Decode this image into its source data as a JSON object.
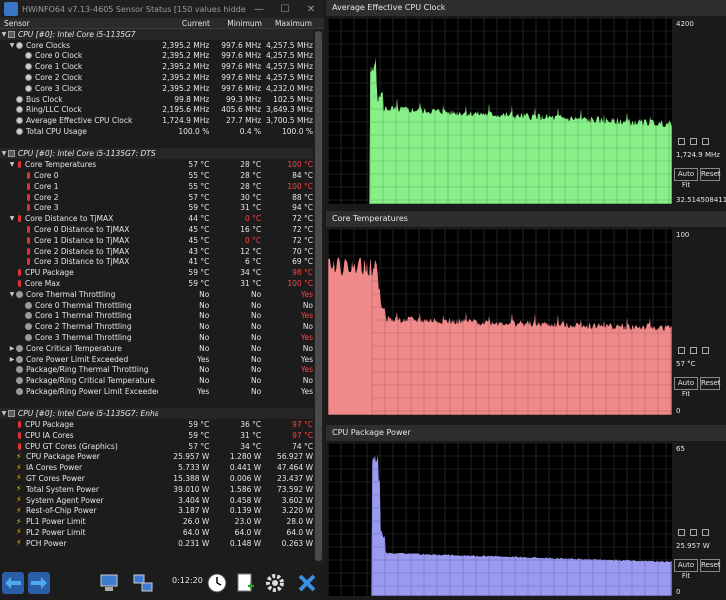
{
  "window": {
    "title": "HWiNFO64 v7.13-4605 Sensor Status [150 values hidden]",
    "min_icon": "minimize-icon",
    "max_icon": "maximize-icon",
    "close_icon": "close-icon"
  },
  "columns": {
    "sensor": "Sensor",
    "current": "Current",
    "minimum": "Minimum",
    "maximum": "Maximum"
  },
  "rows": [
    {
      "type": "group",
      "indent": 0,
      "icon": "cpu-chip-icon",
      "name": "CPU [#0]: Intel Core i5-1135G7"
    },
    {
      "indent": 1,
      "icon": "clock-icon",
      "expand": "v",
      "name": "Core Clocks",
      "cur": "2,395.2 MHz",
      "min": "997.6 MHz",
      "max": "4,257.5 MHz"
    },
    {
      "indent": 2,
      "icon": "clock-icon",
      "name": "Core 0 Clock",
      "cur": "2,395.2 MHz",
      "min": "997.6 MHz",
      "max": "4,257.5 MHz"
    },
    {
      "indent": 2,
      "icon": "clock-icon",
      "name": "Core 1 Clock",
      "cur": "2,395.2 MHz",
      "min": "997.6 MHz",
      "max": "4,257.5 MHz"
    },
    {
      "indent": 2,
      "icon": "clock-icon",
      "name": "Core 2 Clock",
      "cur": "2,395.2 MHz",
      "min": "997.6 MHz",
      "max": "4,257.5 MHz"
    },
    {
      "indent": 2,
      "icon": "clock-icon",
      "name": "Core 3 Clock",
      "cur": "2,395.2 MHz",
      "min": "997.6 MHz",
      "max": "4,232.0 MHz"
    },
    {
      "indent": 1,
      "icon": "clock-icon",
      "name": "Bus Clock",
      "cur": "99.8 MHz",
      "min": "99.3 MHz",
      "max": "102.5 MHz"
    },
    {
      "indent": 1,
      "icon": "clock-icon",
      "name": "Ring/LLC Clock",
      "cur": "2,195.6 MHz",
      "min": "405.6 MHz",
      "max": "3,649.3 MHz"
    },
    {
      "indent": 1,
      "icon": "clock-icon",
      "name": "Average Effective CPU Clock",
      "cur": "1,724.9 MHz",
      "min": "27.7 MHz",
      "max": "3,700.5 MHz"
    },
    {
      "indent": 1,
      "icon": "clock-icon",
      "name": "Total CPU Usage",
      "cur": "100.0 %",
      "min": "0.4 %",
      "max": "100.0 %"
    },
    {
      "type": "spacer"
    },
    {
      "type": "group",
      "indent": 0,
      "icon": "cpu-chip-icon",
      "name": "CPU [#0]: Intel Core i5-1135G7: DTS"
    },
    {
      "indent": 1,
      "icon": "thermometer-icon",
      "expand": "v",
      "name": "Core Temperatures",
      "cur": "57 °C",
      "min": "28 °C",
      "max": "100 °C",
      "maxRed": true
    },
    {
      "indent": 2,
      "icon": "thermometer-icon",
      "name": "Core 0",
      "cur": "55 °C",
      "min": "28 °C",
      "max": "84 °C"
    },
    {
      "indent": 2,
      "icon": "thermometer-icon",
      "name": "Core 1",
      "cur": "55 °C",
      "min": "28 °C",
      "max": "100 °C",
      "maxRed": true
    },
    {
      "indent": 2,
      "icon": "thermometer-icon",
      "name": "Core 2",
      "cur": "57 °C",
      "min": "30 °C",
      "max": "88 °C"
    },
    {
      "indent": 2,
      "icon": "thermometer-icon",
      "name": "Core 3",
      "cur": "59 °C",
      "min": "31 °C",
      "max": "94 °C"
    },
    {
      "indent": 1,
      "icon": "thermometer-icon",
      "expand": "v",
      "name": "Core Distance to TjMAX",
      "cur": "44 °C",
      "min": "0 °C",
      "max": "72 °C",
      "minRed": true
    },
    {
      "indent": 2,
      "icon": "thermometer-icon",
      "name": "Core 0 Distance to TjMAX",
      "cur": "45 °C",
      "min": "16 °C",
      "max": "72 °C"
    },
    {
      "indent": 2,
      "icon": "thermometer-icon",
      "name": "Core 1 Distance to TjMAX",
      "cur": "45 °C",
      "min": "0 °C",
      "max": "72 °C",
      "minRed": true
    },
    {
      "indent": 2,
      "icon": "thermometer-icon",
      "name": "Core 2 Distance to TjMAX",
      "cur": "43 °C",
      "min": "12 °C",
      "max": "70 °C"
    },
    {
      "indent": 2,
      "icon": "thermometer-icon",
      "name": "Core 3 Distance to TjMAX",
      "cur": "41 °C",
      "min": "6 °C",
      "max": "69 °C"
    },
    {
      "indent": 1,
      "icon": "thermometer-icon",
      "name": "CPU Package",
      "cur": "59 °C",
      "min": "34 °C",
      "max": "98 °C",
      "maxRed": true
    },
    {
      "indent": 1,
      "icon": "thermometer-icon",
      "name": "Core Max",
      "cur": "59 °C",
      "min": "31 °C",
      "max": "100 °C",
      "maxRed": true
    },
    {
      "indent": 1,
      "icon": "switch-icon",
      "expand": "v",
      "name": "Core Thermal Throttling",
      "cur": "No",
      "min": "No",
      "max": "Yes",
      "maxRed": true
    },
    {
      "indent": 2,
      "icon": "switch-icon",
      "name": "Core 0 Thermal Throttling",
      "cur": "No",
      "min": "No",
      "max": "No"
    },
    {
      "indent": 2,
      "icon": "switch-icon",
      "name": "Core 1 Thermal Throttling",
      "cur": "No",
      "min": "No",
      "max": "Yes",
      "maxRed": true
    },
    {
      "indent": 2,
      "icon": "switch-icon",
      "name": "Core 2 Thermal Throttling",
      "cur": "No",
      "min": "No",
      "max": "No"
    },
    {
      "indent": 2,
      "icon": "switch-icon",
      "name": "Core 3 Thermal Throttling",
      "cur": "No",
      "min": "No",
      "max": "Yes",
      "maxRed": true
    },
    {
      "indent": 1,
      "icon": "switch-icon",
      "expand": ">",
      "name": "Core Critical Temperature",
      "cur": "No",
      "min": "No",
      "max": "No"
    },
    {
      "indent": 1,
      "icon": "switch-icon",
      "expand": ">",
      "name": "Core Power Limit Exceeded",
      "cur": "Yes",
      "min": "No",
      "max": "Yes"
    },
    {
      "indent": 1,
      "icon": "switch-icon",
      "name": "Package/Ring Thermal Throttling",
      "cur": "No",
      "min": "No",
      "max": "Yes",
      "maxRed": true
    },
    {
      "indent": 1,
      "icon": "switch-icon",
      "name": "Package/Ring Critical Temperature",
      "cur": "No",
      "min": "No",
      "max": "No"
    },
    {
      "indent": 1,
      "icon": "switch-icon",
      "name": "Package/Ring Power Limit Exceeded",
      "cur": "Yes",
      "min": "No",
      "max": "Yes"
    },
    {
      "type": "spacer"
    },
    {
      "type": "group",
      "indent": 0,
      "icon": "cpu-chip-icon",
      "name": "CPU [#0]: Intel Core i5-1135G7: Enhanced"
    },
    {
      "indent": 1,
      "icon": "thermometer-icon",
      "name": "CPU Package",
      "cur": "59 °C",
      "min": "36 °C",
      "max": "97 °C",
      "maxRed": true
    },
    {
      "indent": 1,
      "icon": "thermometer-icon",
      "name": "CPU IA Cores",
      "cur": "59 °C",
      "min": "31 °C",
      "max": "97 °C",
      "maxRed": true
    },
    {
      "indent": 1,
      "icon": "thermometer-icon",
      "name": "CPU GT Cores (Graphics)",
      "cur": "57 °C",
      "min": "34 °C",
      "max": "74 °C"
    },
    {
      "indent": 1,
      "icon": "lightning-icon",
      "name": "CPU Package Power",
      "cur": "25.957 W",
      "min": "1.280 W",
      "max": "56.927 W"
    },
    {
      "indent": 1,
      "icon": "lightning-icon",
      "name": "IA Cores Power",
      "cur": "5.733 W",
      "min": "0.441 W",
      "max": "47.464 W"
    },
    {
      "indent": 1,
      "icon": "lightning-icon",
      "name": "GT Cores Power",
      "cur": "15.388 W",
      "min": "0.006 W",
      "max": "23.437 W"
    },
    {
      "indent": 1,
      "icon": "lightning-icon",
      "name": "Total System Power",
      "cur": "39.010 W",
      "min": "1.586 W",
      "max": "73.592 W"
    },
    {
      "indent": 1,
      "icon": "lightning-icon",
      "name": "System Agent Power",
      "cur": "3.404 W",
      "min": "0.458 W",
      "max": "3.602 W"
    },
    {
      "indent": 1,
      "icon": "lightning-icon",
      "name": "Rest-of-Chip Power",
      "cur": "3.187 W",
      "min": "0.139 W",
      "max": "3.220 W"
    },
    {
      "indent": 1,
      "icon": "lightning-icon",
      "name": "PL1 Power Limit",
      "cur": "26.0 W",
      "min": "23.0 W",
      "max": "28.0 W"
    },
    {
      "indent": 1,
      "icon": "lightning-icon",
      "name": "PL2 Power Limit",
      "cur": "64.0 W",
      "min": "64.0 W",
      "max": "64.0 W"
    },
    {
      "indent": 1,
      "icon": "lightning-icon",
      "name": "PCH Power",
      "cur": "0.231 W",
      "min": "0.148 W",
      "max": "0.263 W"
    }
  ],
  "toolbar": {
    "timer": "0:12:20",
    "buttons": [
      "nav-left-right-icon",
      "nav-right-icon",
      "network-computer-icon",
      "network-share-icon",
      "clock-icon",
      "report-icon",
      "settings-gear-icon",
      "close-x-icon"
    ]
  },
  "graphs": [
    {
      "title": "Average Effective CPU Clock",
      "max": "4200",
      "current": "1,724.9 MHz",
      "min": "",
      "footer": "32.5145084114",
      "color": "#88f088",
      "autofit": "Auto Fit",
      "reset": "Reset"
    },
    {
      "title": "Core Temperatures",
      "max": "100",
      "current": "57 °C",
      "min": "0",
      "footer": "",
      "color": "#f08a8a",
      "autofit": "Auto Fit",
      "reset": "Reset"
    },
    {
      "title": "CPU Package Power",
      "max": "65",
      "current": "25.957 W",
      "min": "0",
      "footer": "",
      "color": "#9a9af0",
      "autofit": "Auto Fit",
      "reset": "Reset"
    }
  ]
}
